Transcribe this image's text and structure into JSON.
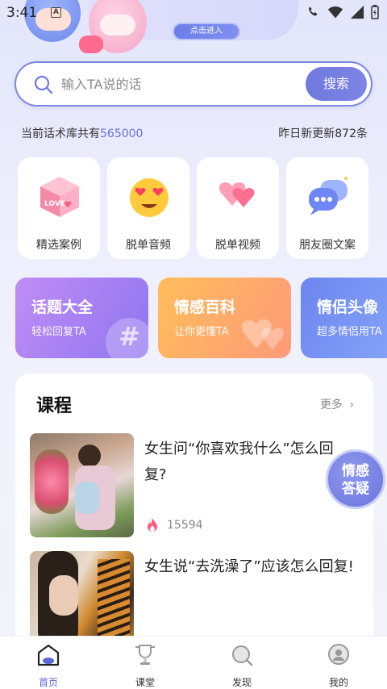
{
  "status_bar": {
    "time": "3:41",
    "notif_letter": "A"
  },
  "banner": {
    "enter_label": "点击进入"
  },
  "search": {
    "placeholder": "输入TA说的话",
    "button_label": "搜索"
  },
  "stats": {
    "prefix": "当前话术库共有",
    "count": "565000",
    "update_text": "昨日新更新872条"
  },
  "features": [
    {
      "label": "精选案例",
      "icon": "love-cube-icon"
    },
    {
      "label": "脱单音频",
      "icon": "heart-eyes-emoji-icon"
    },
    {
      "label": "脱单视频",
      "icon": "hearts-icon"
    },
    {
      "label": "朋友圈文案",
      "icon": "chat-bubbles-icon"
    }
  ],
  "categories": [
    {
      "title": "话题大全",
      "subtitle": "轻松回复TA",
      "color_from": "#b384f2",
      "color_to": "#8f76ef"
    },
    {
      "title": "情感百科",
      "subtitle": "让你更懂TA",
      "color_from": "#fdb15e",
      "color_to": "#ff9a7a"
    },
    {
      "title": "情侣头像",
      "subtitle": "超多情侣用TA",
      "color_from": "#6f8af0",
      "color_to": "#7d9ef6"
    }
  ],
  "course": {
    "title": "课程",
    "more_label": "更多",
    "items": [
      {
        "title": "女生问“你喜欢我什么”怎么回复?",
        "views": "15594"
      },
      {
        "title": "女生说“去洗澡了”应该怎么回复!",
        "views": ""
      }
    ]
  },
  "float_badge": {
    "line1": "情感",
    "line2": "答疑"
  },
  "tabs": [
    {
      "label": "首页",
      "icon": "home-icon",
      "active": true
    },
    {
      "label": "课堂",
      "icon": "trophy-icon",
      "active": false
    },
    {
      "label": "发现",
      "icon": "discover-icon",
      "active": false
    },
    {
      "label": "我的",
      "icon": "profile-icon",
      "active": false
    }
  ],
  "colors": {
    "accent": "#6f78dc",
    "active_tab": "#5d67d6"
  }
}
